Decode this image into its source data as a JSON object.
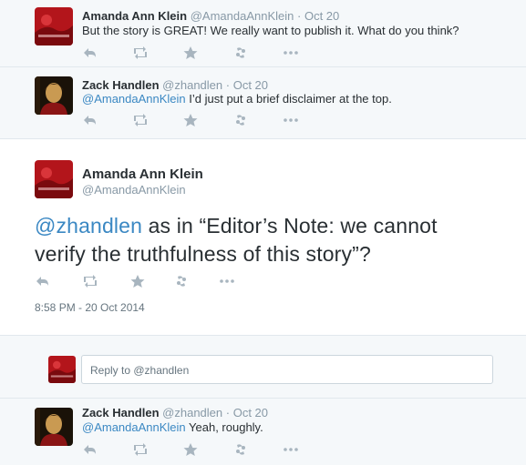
{
  "tweets": [
    {
      "fullname": "Amanda Ann Klein",
      "handle": "@AmandaAnnKlein",
      "time": "Oct 20",
      "text": "But the story is GREAT! We really want to publish it. What do you think?"
    },
    {
      "fullname": "Zack Handlen",
      "handle": "@zhandlen",
      "time": "Oct 20",
      "mention": "@AmandaAnnKlein",
      "text": " I’d just put a brief disclaimer at the top."
    }
  ],
  "main_tweet": {
    "fullname": "Amanda Ann Klein",
    "handle": "@AmandaAnnKlein",
    "mention": "@zhandlen",
    "text_line1": " as in “Editor’s Note: we cannot",
    "text_line2": "verify the truthfulness of this story”?",
    "timestamp": "8:58 PM - 20 Oct 2014"
  },
  "reply_box": {
    "text": "Reply to @zhandlen"
  },
  "reply_tweet": {
    "fullname": "Zack Handlen",
    "handle": "@zhandlen",
    "time": "Oct 20",
    "mention": "@AmandaAnnKlein",
    "text": " Yeah, roughly."
  },
  "separator": "·",
  "icons": [
    "reply-icon",
    "retweet-icon",
    "favorite-icon",
    "follow-icon",
    "more-icon"
  ],
  "colors": {
    "link": "#3b88c3",
    "muted": "#8899a6",
    "icon": "#a8b5bf",
    "background_grey": "#f5f8fa"
  }
}
